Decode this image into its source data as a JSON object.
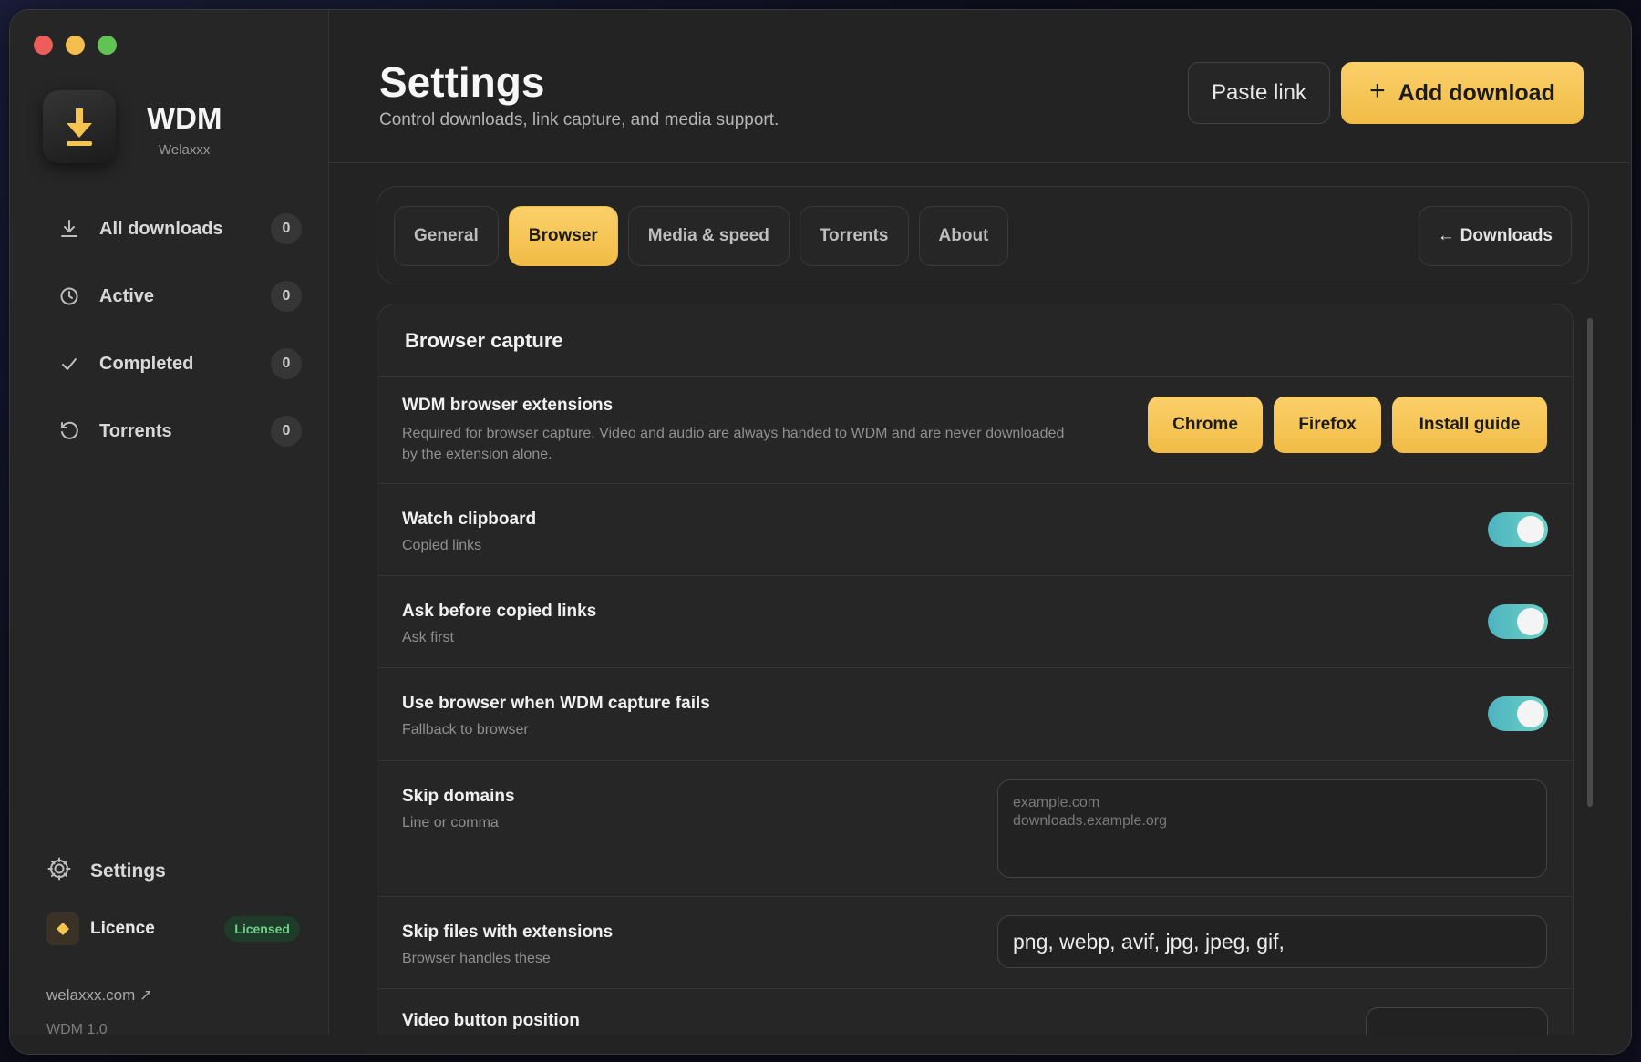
{
  "app": {
    "title": "WDM",
    "subtitle": "Welaxxx",
    "site_link": "welaxxx.com ↗",
    "version": "WDM 1.0"
  },
  "sidebar": {
    "items": [
      {
        "label": "All downloads",
        "count": "0",
        "icon": "download-icon"
      },
      {
        "label": "Active",
        "count": "0",
        "icon": "clock-icon"
      },
      {
        "label": "Completed",
        "count": "0",
        "icon": "check-icon"
      },
      {
        "label": "Torrents",
        "count": "0",
        "icon": "refresh-icon"
      }
    ],
    "settings_label": "Settings",
    "licence_label": "Licence",
    "licence_badge": "Licensed"
  },
  "header": {
    "title": "Settings",
    "subtitle": "Control downloads, link capture, and media support.",
    "paste_label": "Paste link",
    "add_label": "Add download"
  },
  "tabs": [
    "General",
    "Browser",
    "Media & speed",
    "Torrents",
    "About"
  ],
  "active_tab": "Browser",
  "back_label": "Downloads",
  "section": {
    "title": "Browser capture",
    "extensions": {
      "title": "WDM browser extensions",
      "desc": "Required for browser capture. Video and audio are always handed to WDM and are never downloaded by the extension alone.",
      "chrome_label": "Chrome",
      "firefox_label": "Firefox",
      "guide_label": "Install guide"
    },
    "watch_clipboard": {
      "title": "Watch clipboard",
      "desc": "Copied links",
      "enabled": true
    },
    "ask_before": {
      "title": "Ask before copied links",
      "desc": "Ask first",
      "enabled": true
    },
    "fallback": {
      "title": "Use browser when WDM capture fails",
      "desc": "Fallback to browser",
      "enabled": true
    },
    "skip_domains": {
      "title": "Skip domains",
      "desc": "Line or comma",
      "placeholder": "example.com\ndownloads.example.org"
    },
    "skip_ext": {
      "title": "Skip files with extensions",
      "desc": "Browser handles these",
      "value": "png, webp, avif, jpg, jpeg, gif,"
    },
    "video_position": {
      "title": "Video button position"
    }
  },
  "colors": {
    "accent": "#f5c451",
    "toggle_on": "#5cc4c4",
    "licensed_badge": "#6fcf8c"
  }
}
